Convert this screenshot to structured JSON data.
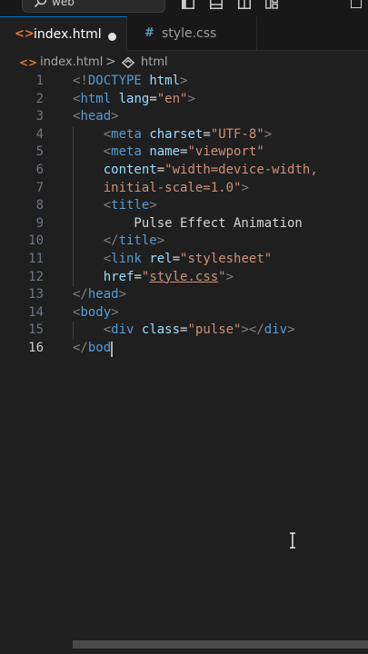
{
  "titlebar": {
    "search_text": "web",
    "search_icon": "search-icon",
    "layout_icons": [
      "toggle-primary-sidebar-icon",
      "toggle-panel-icon",
      "toggle-secondary-sidebar-icon",
      "customize-layout-icon"
    ],
    "window_control_icon": "restore-icon"
  },
  "tabs": [
    {
      "icon": "<>",
      "label": "index.html",
      "modified": true,
      "active": true
    },
    {
      "icon": "#",
      "label": "style.css",
      "modified": false,
      "active": false
    }
  ],
  "breadcrumb": {
    "file_icon": "<>",
    "file": "index.html",
    "separator": ">",
    "symbol_icon": "symbol-element-icon",
    "element": "html"
  },
  "editor": {
    "current_line": 16,
    "lines": [
      {
        "n": "1",
        "tokens": [
          [
            "tag",
            "<!"
          ],
          [
            "name",
            "DOCTYPE"
          ],
          [
            "text",
            " "
          ],
          [
            "attr",
            "html"
          ],
          [
            "tag",
            ">"
          ]
        ]
      },
      {
        "n": "2",
        "tokens": [
          [
            "tag",
            "<"
          ],
          [
            "name",
            "html"
          ],
          [
            "text",
            " "
          ],
          [
            "attr",
            "lang"
          ],
          [
            "eq",
            "="
          ],
          [
            "str",
            "\"en\""
          ],
          [
            "tag",
            ">"
          ]
        ]
      },
      {
        "n": "3",
        "tokens": [
          [
            "tag",
            "<"
          ],
          [
            "name",
            "head"
          ],
          [
            "tag",
            ">"
          ]
        ]
      },
      {
        "n": "4",
        "tokens": [
          [
            "text",
            "    "
          ],
          [
            "tag",
            "<"
          ],
          [
            "name",
            "meta"
          ],
          [
            "text",
            " "
          ],
          [
            "attr",
            "charset"
          ],
          [
            "eq",
            "="
          ],
          [
            "str",
            "\"UTF-8\""
          ],
          [
            "tag",
            ">"
          ]
        ]
      },
      {
        "n": "5",
        "tokens": [
          [
            "text",
            "    "
          ],
          [
            "tag",
            "<"
          ],
          [
            "name",
            "meta"
          ],
          [
            "text",
            " "
          ],
          [
            "attr",
            "name"
          ],
          [
            "eq",
            "="
          ],
          [
            "str",
            "\"viewport\""
          ]
        ]
      },
      {
        "n": "6",
        "tokens": [
          [
            "text",
            "    "
          ],
          [
            "attr",
            "content"
          ],
          [
            "eq",
            "="
          ],
          [
            "str",
            "\"width=device-width,"
          ]
        ]
      },
      {
        "n": "7",
        "tokens": [
          [
            "text",
            "    "
          ],
          [
            "str",
            "initial-scale=1.0\""
          ],
          [
            "tag",
            ">"
          ]
        ]
      },
      {
        "n": "8",
        "tokens": [
          [
            "text",
            "    "
          ],
          [
            "tag",
            "<"
          ],
          [
            "name",
            "title"
          ],
          [
            "tag",
            ">"
          ]
        ]
      },
      {
        "n": "9",
        "tokens": [
          [
            "text",
            "        Pulse Effect Animation"
          ]
        ]
      },
      {
        "n": "10",
        "tokens": [
          [
            "text",
            "    "
          ],
          [
            "tag",
            "</"
          ],
          [
            "name",
            "title"
          ],
          [
            "tag",
            ">"
          ]
        ]
      },
      {
        "n": "11",
        "tokens": [
          [
            "text",
            "    "
          ],
          [
            "tag",
            "<"
          ],
          [
            "name",
            "link"
          ],
          [
            "text",
            " "
          ],
          [
            "attr",
            "rel"
          ],
          [
            "eq",
            "="
          ],
          [
            "str",
            "\"stylesheet\""
          ]
        ]
      },
      {
        "n": "12",
        "tokens": [
          [
            "text",
            "    "
          ],
          [
            "attr",
            "href"
          ],
          [
            "eq",
            "="
          ],
          [
            "str",
            "\""
          ],
          [
            "stru",
            "style.css"
          ],
          [
            "str",
            "\""
          ],
          [
            "tag",
            ">"
          ]
        ]
      },
      {
        "n": "13",
        "tokens": [
          [
            "tag",
            "</"
          ],
          [
            "name",
            "head"
          ],
          [
            "tag",
            ">"
          ]
        ]
      },
      {
        "n": "14",
        "tokens": [
          [
            "tag",
            "<"
          ],
          [
            "name",
            "body"
          ],
          [
            "tag",
            ">"
          ]
        ]
      },
      {
        "n": "15",
        "tokens": [
          [
            "text",
            "    "
          ],
          [
            "tag",
            "<"
          ],
          [
            "name",
            "div"
          ],
          [
            "text",
            " "
          ],
          [
            "attr",
            "class"
          ],
          [
            "eq",
            "="
          ],
          [
            "str",
            "\"pulse\""
          ],
          [
            "tag",
            "></"
          ],
          [
            "name",
            "div"
          ],
          [
            "tag",
            ">"
          ]
        ]
      },
      {
        "n": "16",
        "tokens": [
          [
            "tag",
            "</"
          ],
          [
            "name",
            "bod"
          ]
        ]
      }
    ]
  },
  "colors": {
    "background": "#1f1f1f",
    "accent": "#0078d4",
    "tag": "#808080",
    "element": "#569cd6",
    "attribute": "#9cdcfe",
    "string": "#ce9178"
  }
}
